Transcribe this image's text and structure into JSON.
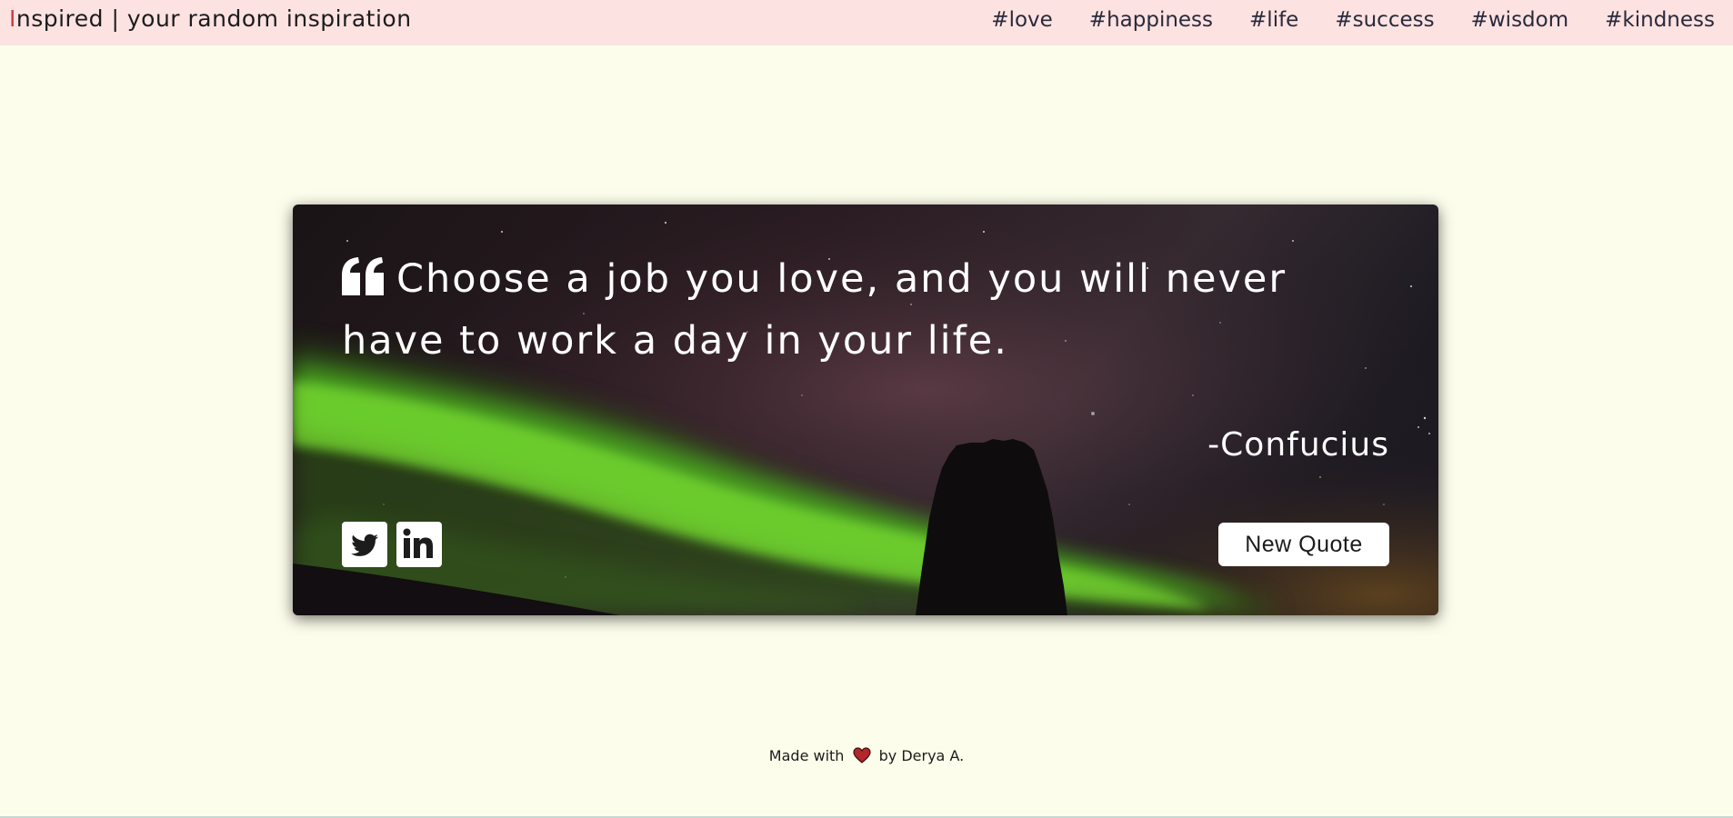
{
  "header": {
    "brand_initial": "I",
    "brand_rest": "nspired | your random inspiration",
    "nav": [
      "#love",
      "#happiness",
      "#life",
      "#success",
      "#wisdom",
      "#kindness"
    ]
  },
  "quote_card": {
    "text": "Choose a job you love, and you will never have to work a day in your life.",
    "author": "-Confucius",
    "new_quote_label": "New Quote",
    "share_icons": [
      "twitter-icon",
      "linkedin-icon"
    ],
    "quote_icon": "quote-left-icon"
  },
  "footer": {
    "made_with": "Made with",
    "by": "by Derya A.",
    "heart_icon": "heart-icon"
  },
  "colors": {
    "page_background": "#fcfdeb",
    "header_background": "#fde2e2",
    "brand_initial": "#d03a3a",
    "aurora_green": "#5fd62a",
    "heart": "#b3262b"
  }
}
